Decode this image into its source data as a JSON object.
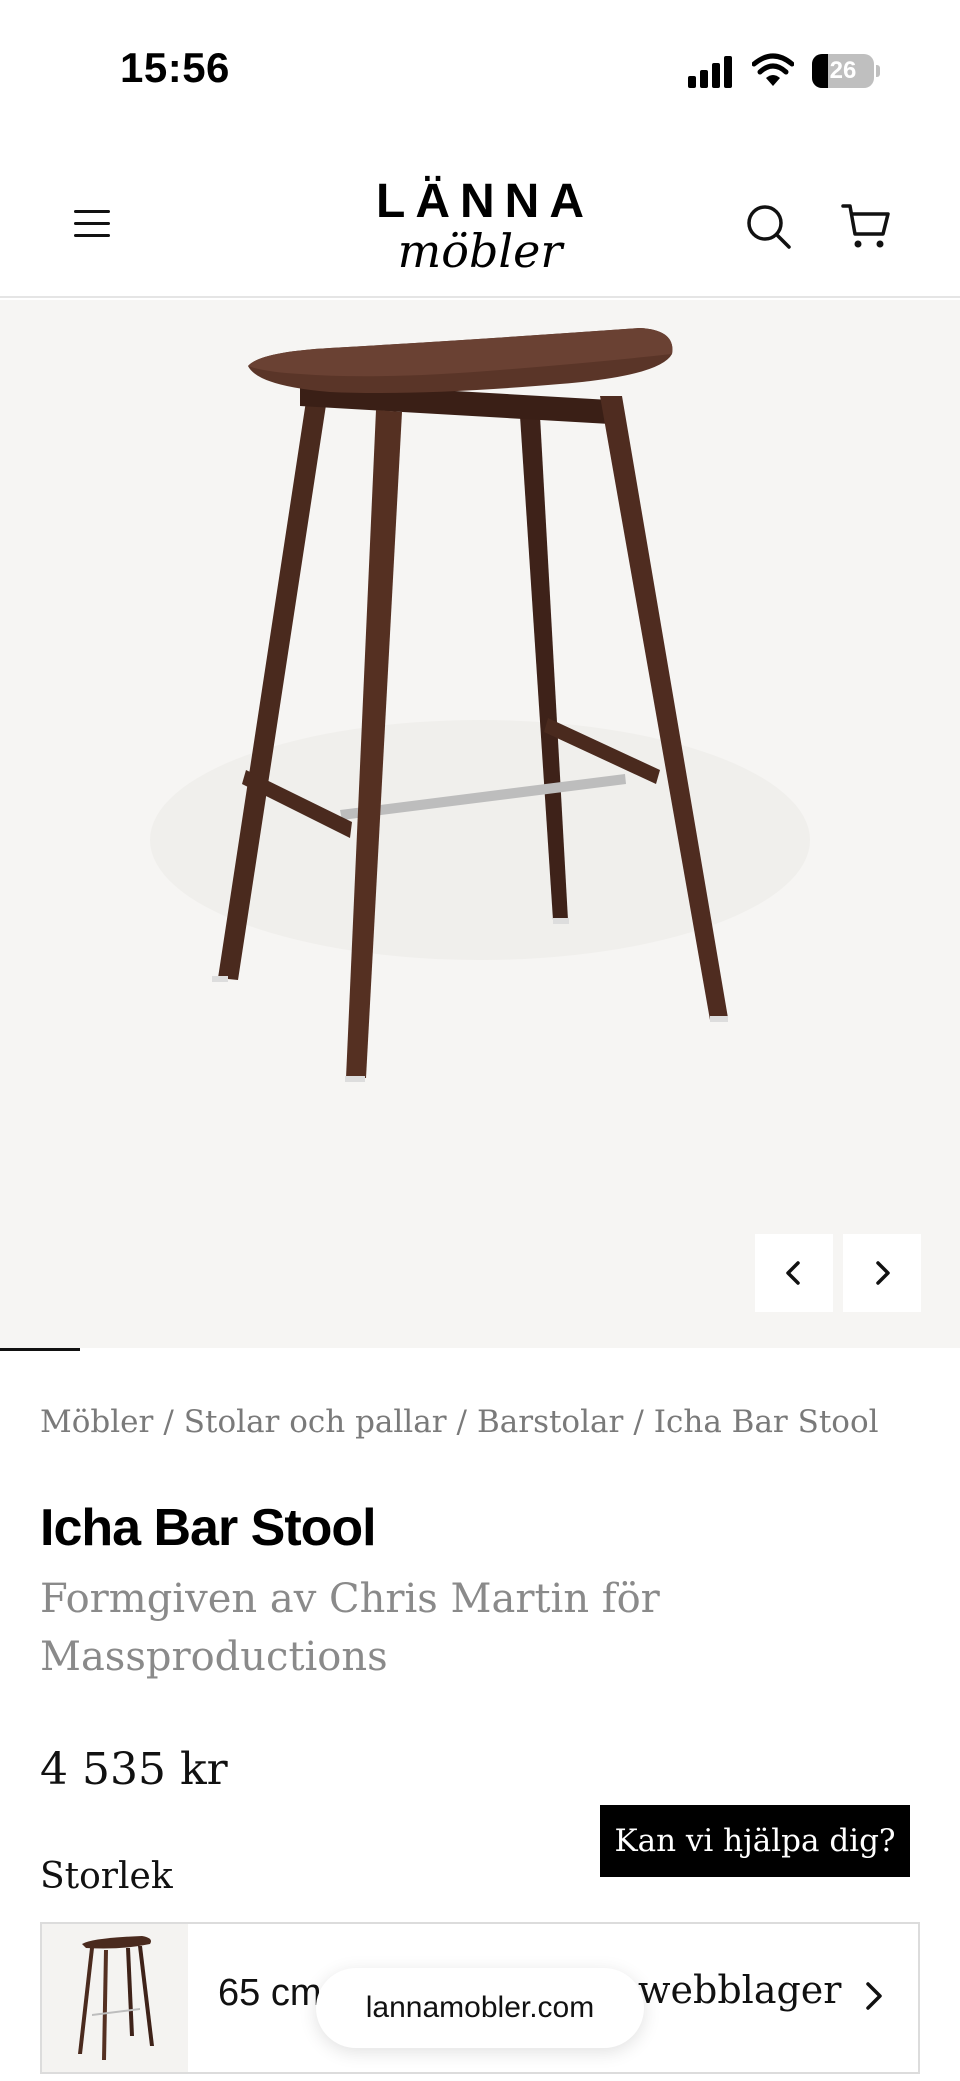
{
  "status_bar": {
    "time": "15:56",
    "battery_level": "26",
    "icons": [
      "signal-icon",
      "wifi-icon",
      "battery-icon"
    ]
  },
  "header": {
    "logo_line1": "LÄNNA",
    "logo_line2": "möbler",
    "icons": [
      "menu-icon",
      "search-icon",
      "cart-icon"
    ]
  },
  "gallery": {
    "progress_fraction": 0.083,
    "icons": [
      "chevron-left-icon",
      "chevron-right-icon"
    ]
  },
  "breadcrumb": [
    "Möbler",
    "Stolar och pallar",
    "Barstolar",
    "Icha Bar Stool"
  ],
  "breadcrumb_separator": "/",
  "product": {
    "title": "Icha Bar Stool",
    "designer": "Formgiven av Chris Martin för Massproductions",
    "price": "4 535 kr",
    "size_label": "Storlek",
    "size_value": "65 cm",
    "stock_text": "webblager"
  },
  "help": {
    "label": "Kan vi hjälpa dig?"
  },
  "browser": {
    "url": "lannamobler.com"
  },
  "colors": {
    "accent": "#000000",
    "muted_text": "#8a8a8a",
    "image_bg": "#f6f5f3",
    "wood": "#4a2a1e"
  }
}
